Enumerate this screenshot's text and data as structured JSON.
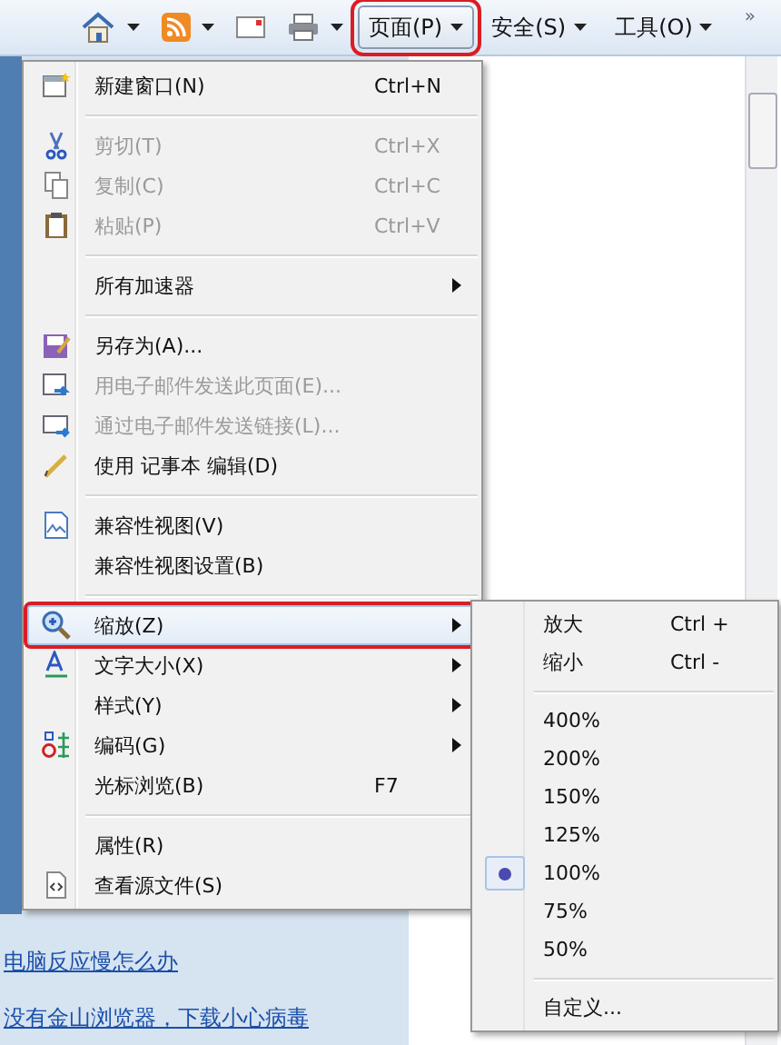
{
  "toolbar": {
    "buttons": [
      {
        "kind": "home",
        "dropdown": true
      },
      {
        "kind": "feed",
        "dropdown": true
      },
      {
        "kind": "mail",
        "dropdown": false
      },
      {
        "kind": "print",
        "dropdown": true
      }
    ],
    "menus": [
      {
        "label": "页面(P)",
        "selected": true
      },
      {
        "label": "安全(S)",
        "selected": false
      },
      {
        "label": "工具(O)",
        "selected": false
      }
    ],
    "overflow": "»"
  },
  "menu": {
    "items": [
      {
        "kind": "item",
        "label": "新建窗口(N)",
        "shortcut": "Ctrl+N",
        "disabled": false,
        "submenu": false,
        "selected": false
      },
      {
        "kind": "separator"
      },
      {
        "kind": "item",
        "label": "剪切(T)",
        "shortcut": "Ctrl+X",
        "disabled": true,
        "submenu": false,
        "selected": false
      },
      {
        "kind": "item",
        "label": "复制(C)",
        "shortcut": "Ctrl+C",
        "disabled": true,
        "submenu": false,
        "selected": false
      },
      {
        "kind": "item",
        "label": "粘贴(P)",
        "shortcut": "Ctrl+V",
        "disabled": true,
        "submenu": false,
        "selected": false
      },
      {
        "kind": "separator"
      },
      {
        "kind": "item",
        "label": "所有加速器",
        "disabled": false,
        "submenu": true,
        "selected": false
      },
      {
        "kind": "separator"
      },
      {
        "kind": "item",
        "label": "另存为(A)...",
        "disabled": false,
        "submenu": false,
        "selected": false
      },
      {
        "kind": "item",
        "label": "用电子邮件发送此页面(E)...",
        "disabled": true,
        "submenu": false,
        "selected": false
      },
      {
        "kind": "item",
        "label": "通过电子邮件发送链接(L)...",
        "disabled": true,
        "submenu": false,
        "selected": false
      },
      {
        "kind": "item",
        "label": "使用 记事本 编辑(D)",
        "disabled": false,
        "submenu": false,
        "selected": false
      },
      {
        "kind": "separator"
      },
      {
        "kind": "item",
        "label": "兼容性视图(V)",
        "disabled": false,
        "submenu": false,
        "selected": false
      },
      {
        "kind": "item",
        "label": "兼容性视图设置(B)",
        "disabled": false,
        "submenu": false,
        "selected": false
      },
      {
        "kind": "separator"
      },
      {
        "kind": "item",
        "label": "缩放(Z)",
        "disabled": false,
        "submenu": true,
        "selected": true
      },
      {
        "kind": "item",
        "label": "文字大小(X)",
        "disabled": false,
        "submenu": true,
        "selected": false
      },
      {
        "kind": "item",
        "label": "样式(Y)",
        "disabled": false,
        "submenu": true,
        "selected": false
      },
      {
        "kind": "item",
        "label": "编码(G)",
        "disabled": false,
        "submenu": true,
        "selected": false
      },
      {
        "kind": "item",
        "label": "光标浏览(B)",
        "shortcut": "F7",
        "disabled": false,
        "submenu": false,
        "selected": false
      },
      {
        "kind": "separator"
      },
      {
        "kind": "item",
        "label": "属性(R)",
        "disabled": false,
        "submenu": false,
        "selected": false
      },
      {
        "kind": "item",
        "label": "查看源文件(S)",
        "disabled": false,
        "submenu": false,
        "selected": false
      }
    ]
  },
  "submenu": {
    "items": [
      {
        "kind": "item",
        "label": "放大",
        "shortcut": "Ctrl +",
        "checked": false
      },
      {
        "kind": "item",
        "label": "缩小",
        "shortcut": "Ctrl -",
        "checked": false
      },
      {
        "kind": "separator"
      },
      {
        "kind": "item",
        "label": "400%",
        "checked": false
      },
      {
        "kind": "item",
        "label": "200%",
        "checked": false
      },
      {
        "kind": "item",
        "label": "150%",
        "checked": false
      },
      {
        "kind": "item",
        "label": "125%",
        "checked": false
      },
      {
        "kind": "item",
        "label": "100%",
        "checked": true
      },
      {
        "kind": "item",
        "label": "75%",
        "checked": false
      },
      {
        "kind": "item",
        "label": "50%",
        "checked": false
      },
      {
        "kind": "separator"
      },
      {
        "kind": "item",
        "label": "自定义...",
        "checked": false
      }
    ]
  },
  "page": {
    "links": [
      "电脑反应慢怎么办",
      "没有金山浏览器，下载小心病毒"
    ]
  }
}
